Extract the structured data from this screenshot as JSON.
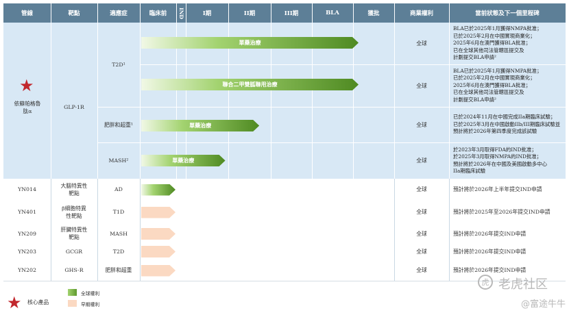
{
  "header": {
    "columns": [
      "管線",
      "靶點",
      "適應症",
      "臨床前",
      "IND",
      "I期",
      "II期",
      "III期",
      "BLA",
      "獲批",
      "商業權利",
      "當前狀態及下一個里程碑"
    ]
  },
  "featured": {
    "name": "依蘇帕格魯肽α",
    "target": "GLP-1R",
    "indications": [
      {
        "label": "T2D¹"
      },
      {
        "label": "肥胖和超重¹"
      },
      {
        "label": "MASH²"
      }
    ],
    "rows": [
      {
        "bar_label": "單藥治療",
        "bar_stage": 6.0,
        "rights": "全球",
        "status": [
          "BLA已於2025年1月獲得NMPA批准；",
          "已於2025年2月在中國實現商業化；",
          "2025年6月在澳門獲得BLA批准；",
          "已在全球其他司法管轄區提交及",
          "計劃提交BLA申請²"
        ]
      },
      {
        "bar_label": "聯合二甲雙胍聯用治療",
        "bar_stage": 6.0,
        "rights": "全球",
        "status": [
          "BLA已於2025年1月獲得NMPA批准；",
          "已於2025年2月在中國實現商業化；",
          "2025年6月在澳門獲得BLA批准；",
          "已在全球其他司法管轄區提交及",
          "計劃提交BLA申請²"
        ]
      },
      {
        "bar_label": "單藥治療",
        "bar_stage": 3.6,
        "rights": "全球",
        "status": [
          "已於2024年11月在中國完成IIa期臨床試驗；",
          "已於2025年3月在中國啟動IIb/III期臨床試驗並",
          "預計將於2026年第四季度完成該試驗"
        ]
      },
      {
        "bar_label": "單藥治療",
        "bar_stage": 2.8,
        "rights": "全球",
        "status": [
          "於2023年3月取得FDA的IND批准；",
          "於2025年3月取得NMPA的IND批准；",
          "預計將於2026年在中國及美國啟動多中心",
          "IIa期臨床試驗"
        ]
      }
    ]
  },
  "early_rows": [
    {
      "pipeline": "YN014",
      "target": [
        "大腦特異性",
        "靶點"
      ],
      "indication": "AD",
      "phase": "green",
      "rights": "全球",
      "status": "預計將於2026年上半年提交IND申請"
    },
    {
      "pipeline": "YN401",
      "target": [
        "β細胞特異",
        "性靶點"
      ],
      "indication": "T1D",
      "phase": "peach",
      "rights": "全球",
      "status": "預計將於2025年至2026年提交IND申請"
    },
    {
      "pipeline": "YN209",
      "target": [
        "肝臟特異性",
        "靶點"
      ],
      "indication": "MASH",
      "phase": "peach",
      "rights": "全球",
      "status": "預計將於2026年提交IND申請"
    },
    {
      "pipeline": "YN203",
      "target": [
        "GCGR"
      ],
      "indication": "T2D",
      "phase": "peach",
      "rights": "全球",
      "status": "預計將於2026年提交IND申請"
    },
    {
      "pipeline": "YN202",
      "target": [
        "GHS-R"
      ],
      "indication": "肥胖和超重",
      "phase": "peach",
      "rights": "全球",
      "status": "預計將於2026年提交IND申請"
    }
  ],
  "legend": {
    "core_label": "核心產品",
    "global_label": "全球權利",
    "early_label": "早期權利"
  },
  "watermark": {
    "brand": "老虎社区",
    "handle": "@富途牛牛"
  },
  "colors": {
    "header": "#5d7f97",
    "featured_bg": "#d8e8f5",
    "bar_green": "#4f8a22",
    "bar_peach": "#fbd9c2",
    "star": "#c1272d"
  }
}
